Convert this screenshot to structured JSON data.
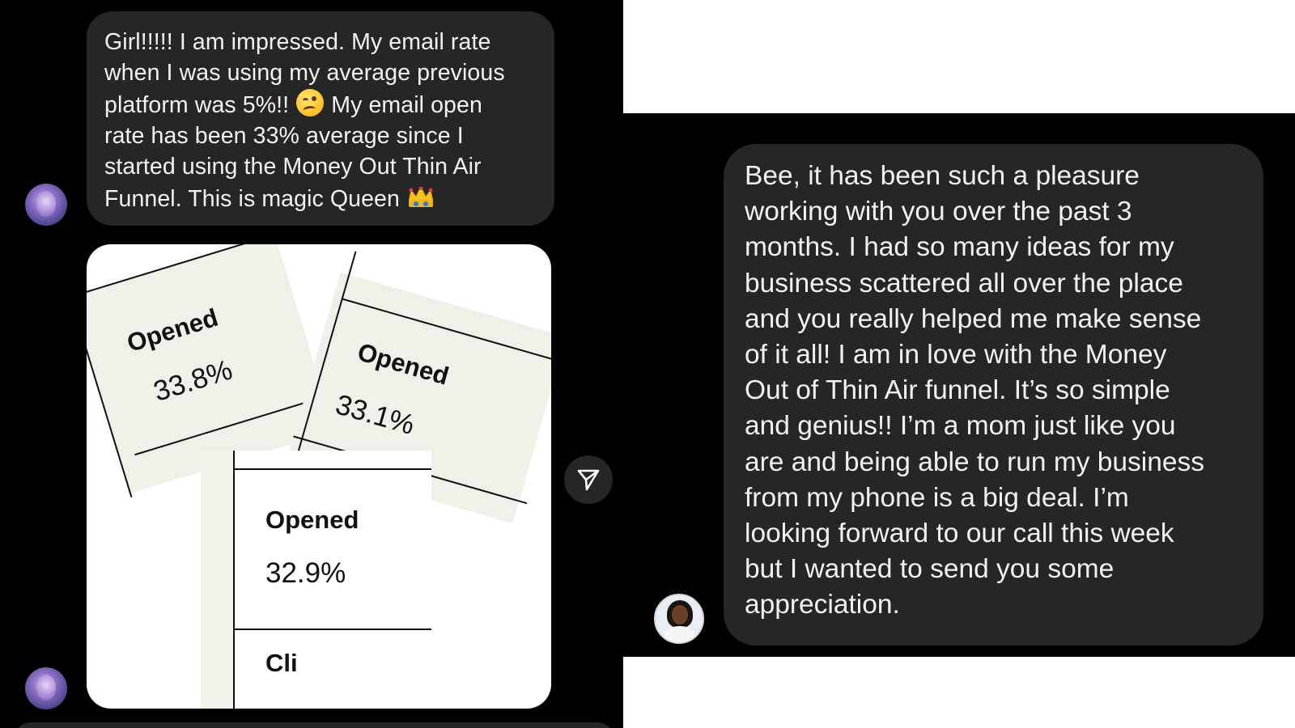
{
  "left_chat": {
    "message_lines": [
      "Girl!!!!! I am impressed.  My email rate",
      "when I was using my average previous",
      "platform was 5%!!",
      "My email open",
      "rate has been 33% average since I",
      "started using the Money Out Thin Air",
      "Funnel.  This is magic Queen"
    ],
    "image_cards": [
      {
        "label": "Opened",
        "value": "33.8%"
      },
      {
        "label": "Opened",
        "value": "33.1%"
      },
      {
        "label": "Opened",
        "value": "32.9%"
      }
    ],
    "cropped_text": "Cli",
    "icons": {
      "emoji_1": "woozy-face-emoji",
      "emoji_2": "crown-emoji",
      "share": "send-paper-plane-icon"
    }
  },
  "right_chat": {
    "message_lines": [
      "Bee, it has been such a pleasure",
      "working with you over the past 3",
      "months.  I had so many ideas for my",
      "business scattered all over the place",
      "and you really helped me make sense",
      "of it all!  I am in love with the Money",
      "Out of Thin Air funnel.  It’s so simple",
      "and genius!! I’m a mom just like you",
      "are and being able to run my business",
      "from my phone is a big deal.  I’m",
      "looking forward to our call this week",
      "but I wanted to send you some",
      "appreciation."
    ]
  },
  "colors": {
    "chat_background": "#000000",
    "bubble": "#262626",
    "text": "#f2f2f2",
    "page_background": "#ffffff"
  }
}
